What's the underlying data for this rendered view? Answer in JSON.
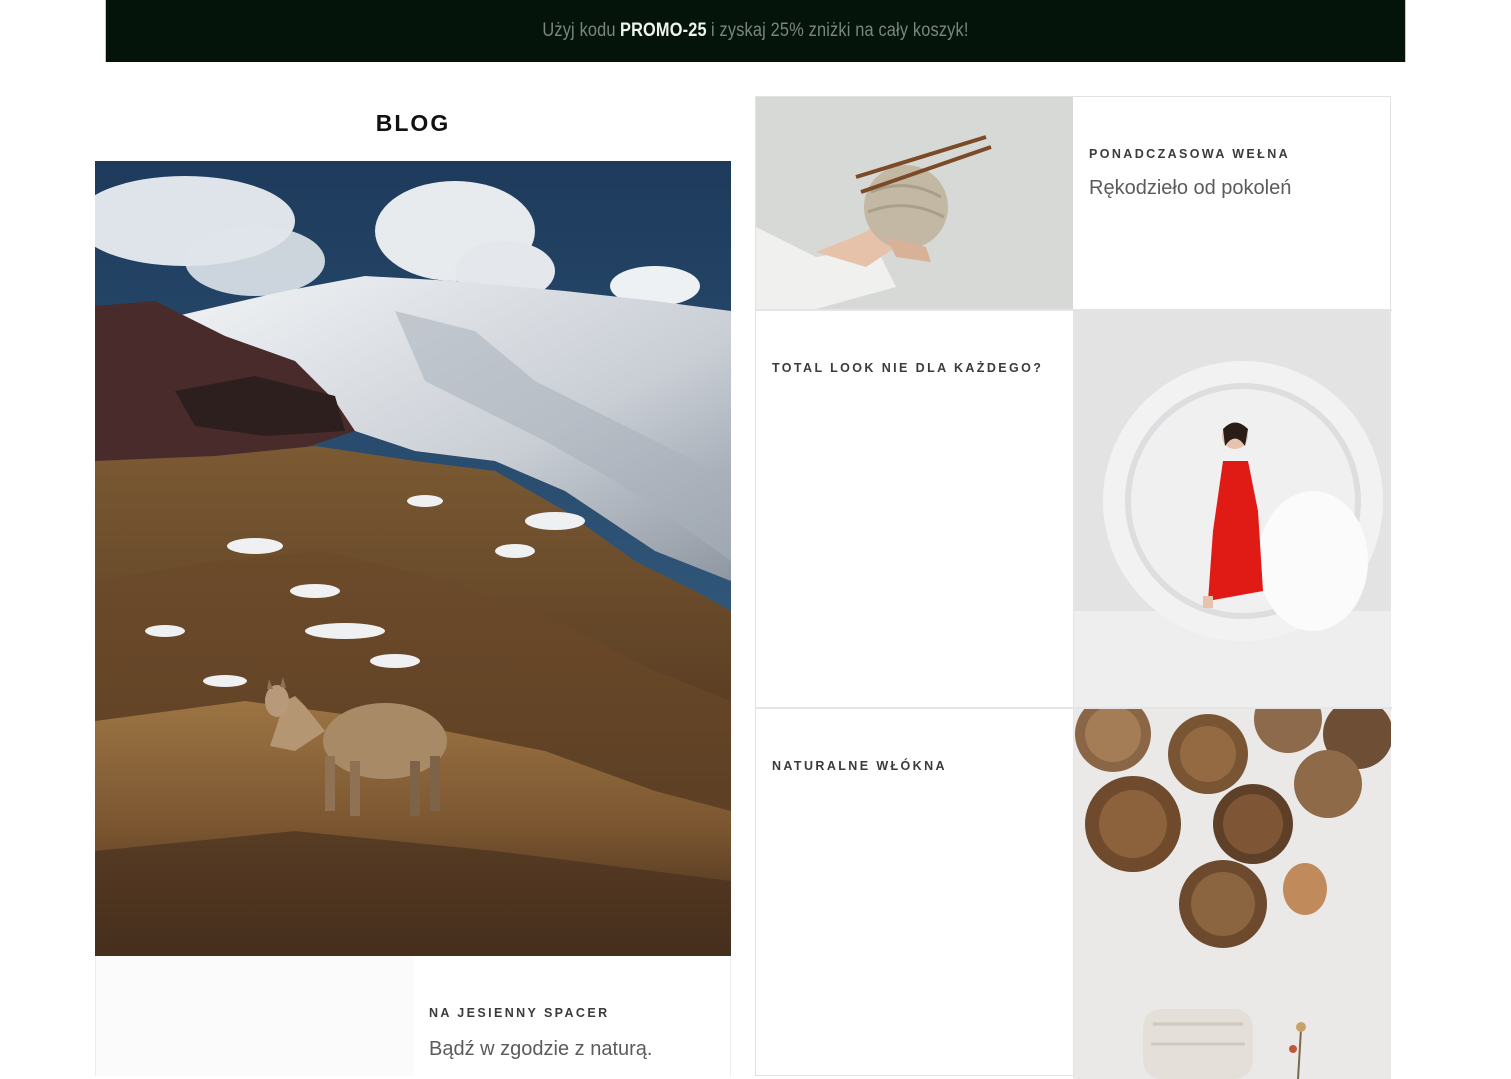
{
  "promo": {
    "prefix": "Użyj kodu",
    "code": "PROMO-25",
    "suffix": "i zyskaj 25% zniżki na cały koszyk!"
  },
  "blog": {
    "title": "BLOG"
  },
  "posts": [
    {
      "eyebrow": "PONADCZASOWA WEŁNA",
      "subtitle": "Rękodzieło od pokoleń",
      "image": "yarn-knitting-needles"
    },
    {
      "eyebrow": "TOTAL LOOK NIE DLA KAŻDEGO?",
      "subtitle": "",
      "image": "woman-red-dress-white-ring"
    },
    {
      "eyebrow": "NATURALNE WŁÓKNA",
      "subtitle": "",
      "image": "woven-baskets-wall"
    },
    {
      "eyebrow": "NA JESIENNY SPACER",
      "subtitle": "Bądź w zgodzie z naturą.",
      "image": "alpaca-mountains"
    }
  ],
  "colors": {
    "promo_bg": "#04140b",
    "promo_text": "#7c857f",
    "promo_code": "#f1f3f0",
    "border": "#e2e2e2"
  }
}
